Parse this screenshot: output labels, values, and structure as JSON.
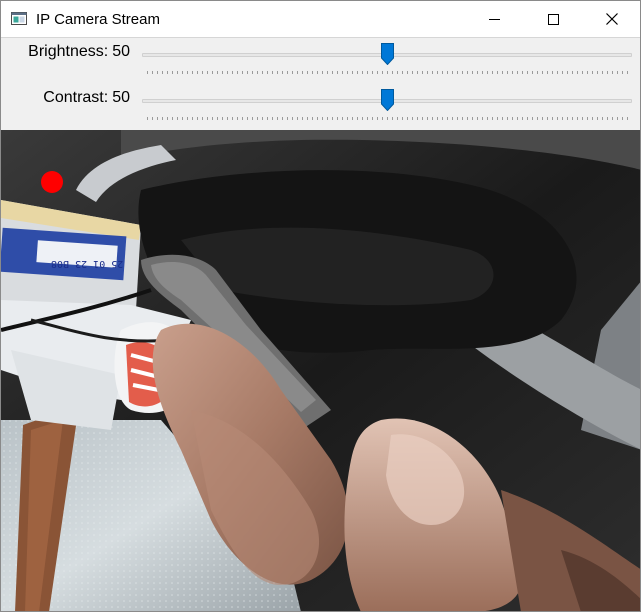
{
  "window": {
    "title": "IP Camera Stream",
    "icons": {
      "app": "window-app-icon",
      "minimize": "minimize-icon",
      "maximize": "maximize-icon",
      "close": "close-icon"
    }
  },
  "trackbars": [
    {
      "label": "Brightness:",
      "value": "50",
      "min": 0,
      "max": 100,
      "level_percent": 50
    },
    {
      "label": "Contrast:",
      "value": "50",
      "min": 0,
      "max": 100,
      "level_percent": 50
    }
  ],
  "camera": {
    "indicator_color": "#ff0000",
    "stamp_text": "25 01 23 B08"
  },
  "colors": {
    "accent": "#0078d7"
  }
}
